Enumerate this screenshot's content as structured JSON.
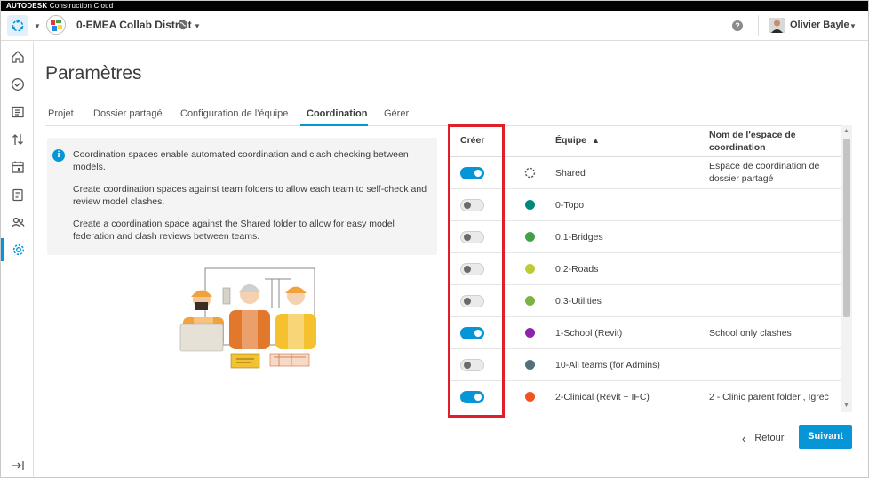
{
  "brand": {
    "bold": "AUTODESK",
    "rest": " Construction Cloud"
  },
  "header": {
    "project_name": "0-EMEA Collab District",
    "user_name": "Olivier Bayle",
    "help_label": "?"
  },
  "sidebar": {
    "items": [
      {
        "icon": "home-icon"
      },
      {
        "icon": "checkmark-circle-icon"
      },
      {
        "icon": "sheets-icon"
      },
      {
        "icon": "transfer-arrows-icon"
      },
      {
        "icon": "calendar-icon"
      },
      {
        "icon": "clipboard-icon"
      },
      {
        "icon": "members-icon"
      },
      {
        "icon": "gear-icon",
        "active": true
      }
    ],
    "collapse_icon": "collapse-sidebar-icon"
  },
  "page": {
    "title": "Paramètres"
  },
  "tabs": [
    {
      "label": "Projet"
    },
    {
      "label": "Dossier partagé"
    },
    {
      "label": "Configuration de l'équipe"
    },
    {
      "label": "Coordination",
      "active": true
    },
    {
      "label": "Gérer"
    }
  ],
  "info": {
    "icon": "info-icon",
    "p1": "Coordination spaces enable automated coordination and clash checking between models.",
    "p2": "Create coordination spaces against team folders to allow each team to self-check and review model clashes.",
    "p3": "Create a coordination space against the Shared folder to allow for easy model federation and clash reviews between teams."
  },
  "table": {
    "col_create": "Créer",
    "col_team": "Équipe",
    "col_space": "Nom de l'espace de coordination",
    "rows": [
      {
        "on": true,
        "color": "shared",
        "team": "Shared",
        "space": "Espace de coordination de dossier partagé"
      },
      {
        "on": false,
        "color": "#00897b",
        "team": "0-Topo",
        "space": ""
      },
      {
        "on": false,
        "color": "#43a047",
        "team": "0.1-Bridges",
        "space": ""
      },
      {
        "on": false,
        "color": "#c0ca33",
        "team": "0.2-Roads",
        "space": ""
      },
      {
        "on": false,
        "color": "#7cb342",
        "team": "0.3-Utilities",
        "space": ""
      },
      {
        "on": true,
        "color": "#8e24aa",
        "team": "1-School (Revit)",
        "space": "School only clashes"
      },
      {
        "on": false,
        "color": "#546e7a",
        "team": "10-All teams (for Admins)",
        "space": ""
      },
      {
        "on": true,
        "color": "#f4511e",
        "team": "2-Clinical (Revit + IFC)",
        "space": "2 - Clinic parent folder , Igrec"
      }
    ]
  },
  "footer": {
    "back_label": "Retour",
    "next_label": "Suivant"
  },
  "colors": {
    "accent": "#0696d7",
    "highlight_box": "#e01f26"
  }
}
